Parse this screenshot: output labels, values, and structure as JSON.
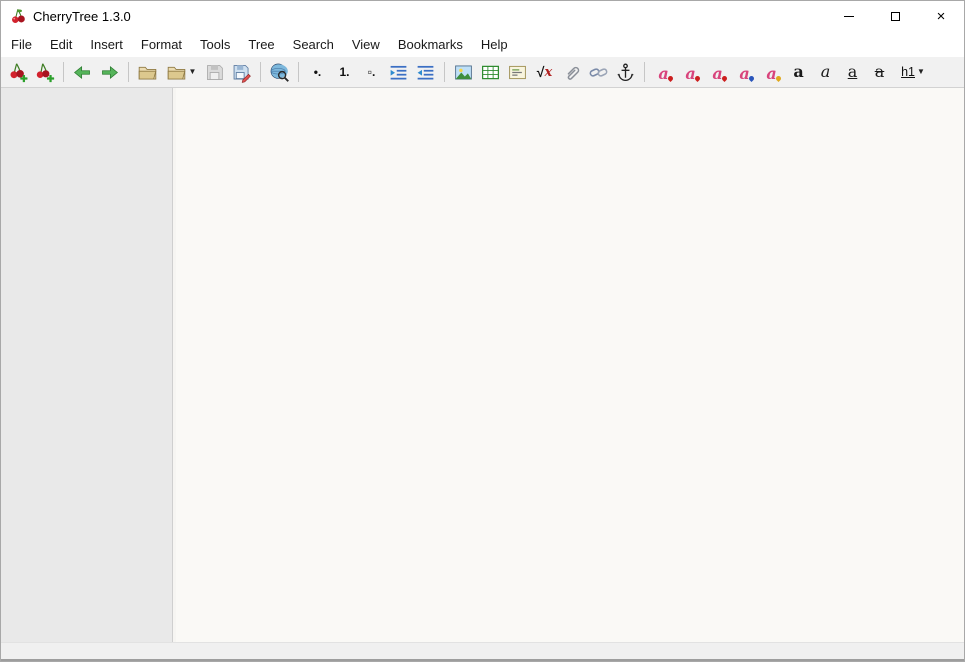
{
  "window": {
    "title": "CherryTree 1.3.0",
    "close_glyph": "×"
  },
  "menubar": {
    "items": [
      "File",
      "Edit",
      "Insert",
      "Format",
      "Tools",
      "Tree",
      "Search",
      "View",
      "Bookmarks",
      "Help"
    ]
  },
  "toolbar": {
    "bullet_list_glyph": "•.",
    "numbered_list_glyph": "1.",
    "todo_list_glyph": "▫.",
    "formula_sqrt": "√",
    "formula_x": "x",
    "letter_a": "a",
    "heading_glyph": "h1",
    "dropdown_glyph": "▼",
    "icons": [
      "new-node",
      "new-subnode",
      "go-back",
      "go-forward",
      "open-file",
      "open-recent",
      "save",
      "save-as",
      "find",
      "bullet-list",
      "numbered-list",
      "todo-list",
      "indent-right",
      "indent-left",
      "insert-image",
      "insert-table",
      "insert-codebox",
      "insert-formula",
      "attach-file",
      "insert-link",
      "insert-anchor",
      "format-latest",
      "remove-formatting",
      "foreground-color",
      "background-color",
      "monospace",
      "bold",
      "italic",
      "underline",
      "strikethrough",
      "heading-1",
      "heading-dropdown"
    ]
  },
  "statusbar": {
    "text": ""
  },
  "colors": {
    "titlebar_bg": "#ffffff",
    "menubar_bg": "#ffffff",
    "toolbar_bg": "#f1f1f1",
    "tree_panel_bg": "#e9e9e9",
    "editor_bg": "#faf9f6",
    "statusbar_bg": "#f0f0f0",
    "cherry_red": "#c8202c",
    "accent_green": "#3f9e46",
    "indent_blue": "#3b6fc4",
    "format_pink": "#d8447c"
  }
}
